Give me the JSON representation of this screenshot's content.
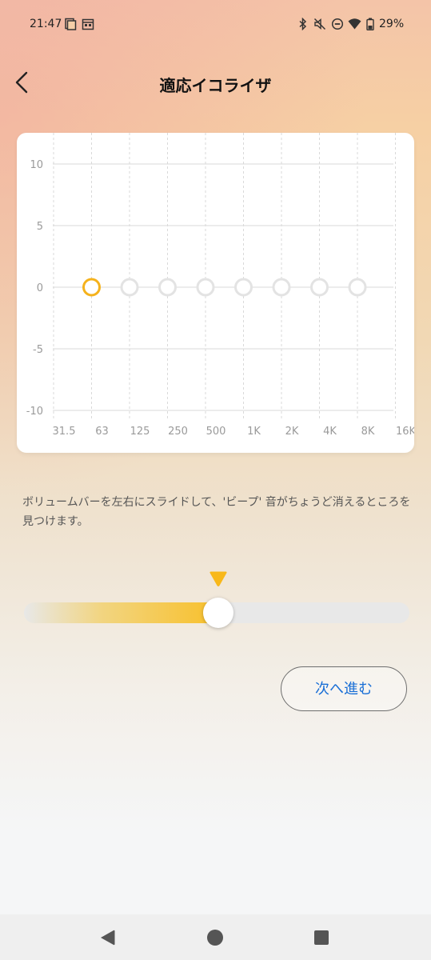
{
  "status_bar": {
    "time": "21:47",
    "battery": "29%",
    "left_icons": [
      "screenshot-icon",
      "calendar-icon"
    ],
    "right_icons": [
      "bluetooth-icon",
      "mute-icon",
      "dnd-icon",
      "wifi-icon",
      "battery-icon"
    ]
  },
  "header": {
    "title": "適応イコライザ",
    "back_icon": "chevron-left-icon"
  },
  "equalizer": {
    "y_ticks": [
      "10",
      "5",
      "0",
      "-5",
      "-10"
    ],
    "bands": [
      "31.5",
      "63",
      "125",
      "250",
      "500",
      "1K",
      "2K",
      "4K",
      "8K",
      "16K"
    ],
    "points": [
      {
        "band": "63",
        "gain": 0,
        "active": true
      },
      {
        "band": "125",
        "gain": 0,
        "active": false
      },
      {
        "band": "250",
        "gain": 0,
        "active": false
      },
      {
        "band": "500",
        "gain": 0,
        "active": false
      },
      {
        "band": "1K",
        "gain": 0,
        "active": false
      },
      {
        "band": "2K",
        "gain": 0,
        "active": false
      },
      {
        "band": "4K",
        "gain": 0,
        "active": false
      },
      {
        "band": "8K",
        "gain": 0,
        "active": false
      }
    ],
    "colors": {
      "active": "#f5b21c",
      "inactive": "#e3e3e3",
      "grid": "#d9d9d9",
      "label": "#9a9a9a"
    }
  },
  "instruction": "ボリュームバーを左右にスライドして、'ビープ' 音がちょうど消えるところを見つけます。",
  "slider": {
    "value": 0.5,
    "accent": "#f8c02c"
  },
  "next_button": "次へ進む",
  "nav_bar": {
    "icons": [
      "back-triangle-icon",
      "home-circle-icon",
      "recents-square-icon"
    ]
  }
}
